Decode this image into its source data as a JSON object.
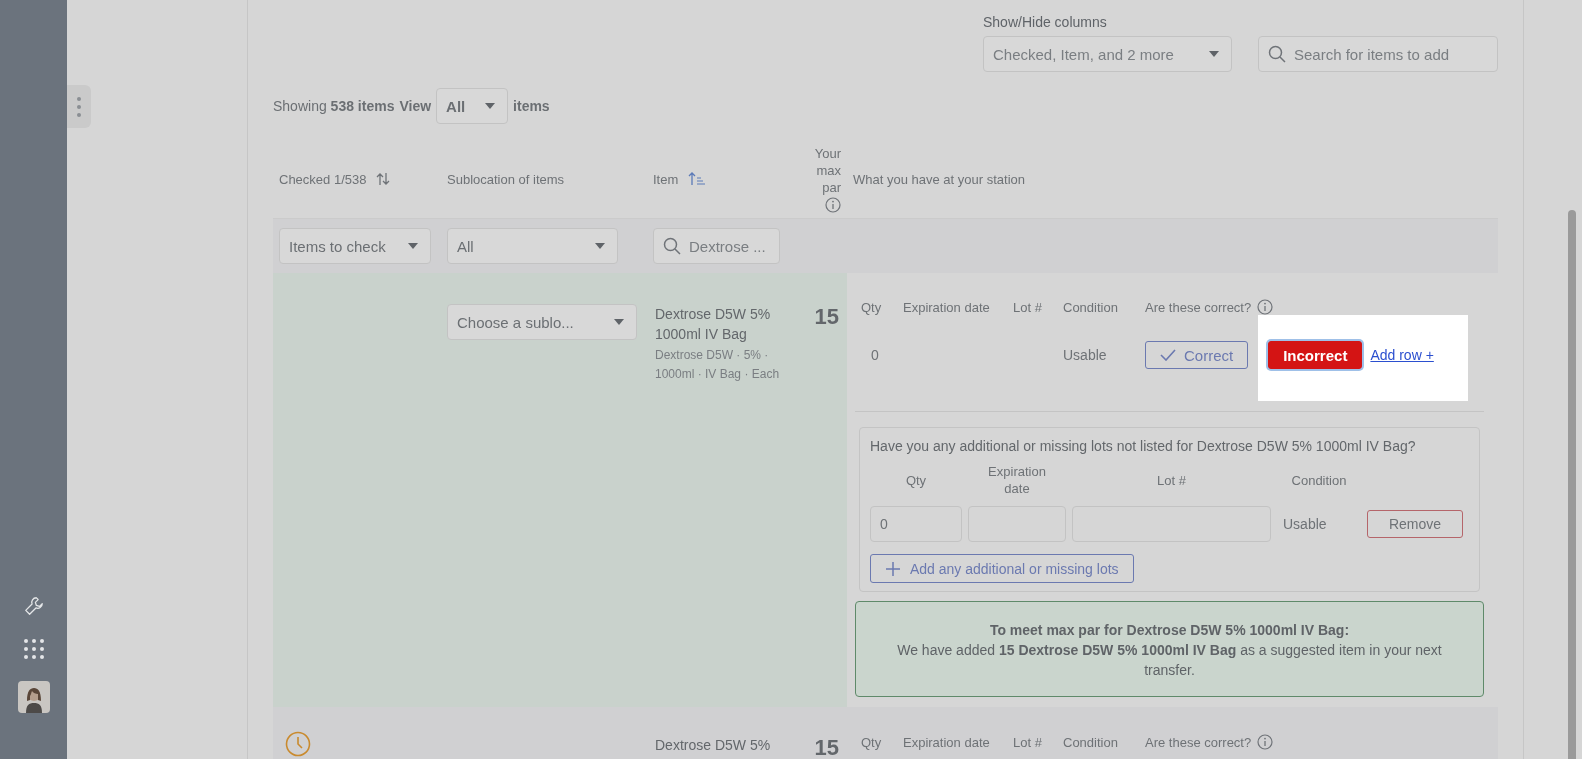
{
  "toolbar": {
    "columns_label": "Show/Hide columns",
    "columns_value": "Checked, Item, and 2 more",
    "search_placeholder": "Search for items to add"
  },
  "summary": {
    "prefix": "Showing",
    "count": "538 items",
    "view_label": "View",
    "view_value": "All",
    "suffix": "items"
  },
  "columns": [
    {
      "label": "Checked 1/538",
      "kind": "sort-both"
    },
    {
      "label": "Sublocation of items",
      "kind": "plain"
    },
    {
      "label": "Item",
      "kind": "sort-asc"
    },
    {
      "label": "Your max par",
      "kind": "info"
    },
    {
      "label": "What you have at your station",
      "kind": "plain"
    }
  ],
  "filters": {
    "checked": "Items to check",
    "sublocation": "All",
    "item": "Dextrose ..."
  },
  "rows": [
    {
      "pending": false,
      "expanded": true,
      "sublocation_placeholder": "Choose a sublo...",
      "name": "Dextrose D5W 5% 1000ml IV Bag",
      "detail": "Dextrose D5W · 5% · 1000ml · IV Bag · Each",
      "max_par": "15",
      "lot_columns": [
        "Qty",
        "Expiration date",
        "Lot #",
        "Condition",
        "Are these correct?"
      ],
      "lots": [
        {
          "qty": "0",
          "condition": "Usable",
          "verdicts": [
            {
              "label": "Correct",
              "selected": false
            },
            {
              "label": "Incorrect",
              "selected": true
            }
          ],
          "add_row": "Add row +"
        }
      ],
      "additional": {
        "question": "Have you any additional or missing lots not listed for Dextrose D5W 5% 1000ml IV Bag?",
        "columns": [
          "Qty",
          "Expiration date",
          "Lot #",
          "Condition"
        ],
        "entries": [
          {
            "qty": "0",
            "condition": "Usable",
            "remove": "Remove"
          }
        ],
        "add_button": "Add any additional or missing lots"
      },
      "notice": {
        "title": "To meet max par for Dextrose D5W 5% 1000ml IV Bag:",
        "body": "We have added **15 Dextrose D5W 5% 1000ml IV Bag** as a suggested item in your next transfer."
      }
    },
    {
      "pending": true,
      "expanded": false,
      "name": "Dextrose D5W 5%",
      "max_par": "15",
      "lot_columns": [
        "Qty",
        "Expiration date",
        "Lot #",
        "Condition",
        "Are these correct?"
      ]
    }
  ]
}
